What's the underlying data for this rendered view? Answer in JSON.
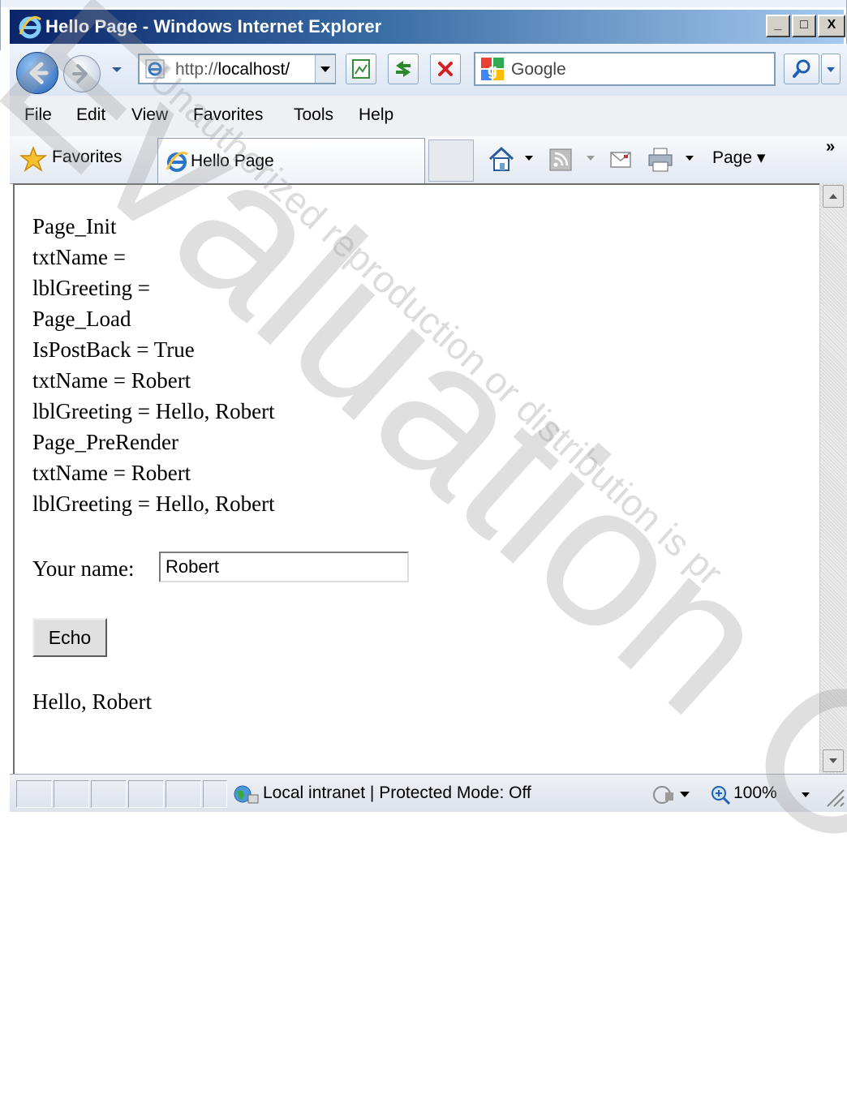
{
  "window": {
    "title": "Hello Page - Windows Internet Explorer",
    "minimize": "_",
    "maximize": "□",
    "close": "X"
  },
  "navigation": {
    "address_prefix": "http://",
    "address_host": "localhost/",
    "search_placeholder": "Google"
  },
  "menu": {
    "items": [
      "File",
      "Edit",
      "View",
      "Favorites",
      "Tools",
      "Help"
    ]
  },
  "favorites_bar": {
    "favorites_label": "Favorites",
    "tab_title": "Hello Page",
    "page_menu": "Page ▾",
    "overflow": "»"
  },
  "page": {
    "trace": [
      "Page_Init",
      "txtName =",
      "lblGreeting =",
      "Page_Load",
      "IsPostBack = True",
      "txtName = Robert",
      "lblGreeting = Hello, Robert",
      "Page_PreRender",
      "txtName = Robert",
      "lblGreeting = Hello, Robert"
    ],
    "name_label": "Your name:",
    "name_value": "Robert",
    "button_label": "Echo",
    "greeting": "Hello, Robert"
  },
  "status": {
    "zone": "Local intranet | Protected Mode: Off",
    "zoom": "100%"
  },
  "icons": {
    "back": "back-arrow-icon",
    "forward": "forward-arrow-icon",
    "refresh": "refresh-icon",
    "stop": "stop-icon",
    "search": "magnifier-icon",
    "home": "home-icon",
    "feeds": "rss-icon",
    "mail": "mail-icon",
    "print": "printer-icon",
    "zone": "globe-icon"
  },
  "colors": {
    "title_gradient_start": "#0a246a",
    "title_gradient_end": "#a6caf0",
    "stop_red": "#d42020",
    "refresh_green": "#2a8a2a"
  },
  "watermark": {
    "main": "Evaluation Copy",
    "sub": "Unauthorized reproduction or distribution is pr"
  }
}
